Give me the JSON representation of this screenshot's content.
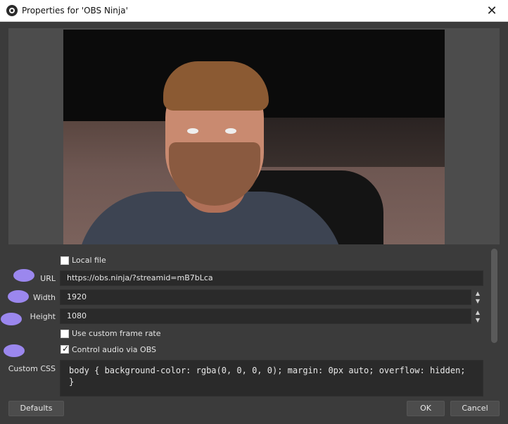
{
  "window": {
    "title": "Properties for 'OBS Ninja'",
    "close_glyph": "✕"
  },
  "form": {
    "local_file_label": "Local file",
    "local_file_checked": false,
    "url_label": "URL",
    "url_value": "https://obs.ninja/?streamid=mB7bLca",
    "width_label": "Width",
    "width_value": "1920",
    "height_label": "Height",
    "height_value": "1080",
    "custom_frame_rate_label": "Use custom frame rate",
    "custom_frame_rate_checked": false,
    "control_audio_label": "Control audio via OBS",
    "control_audio_checked": true,
    "custom_css_label": "Custom CSS",
    "custom_css_value": "body { background-color: rgba(0, 0, 0, 0); margin: 0px auto; overflow: hidden; }"
  },
  "buttons": {
    "defaults": "Defaults",
    "ok": "OK",
    "cancel": "Cancel"
  },
  "icons": {
    "spin_up": "▲",
    "spin_down": "▼"
  },
  "colors": {
    "background": "#3b3b3b",
    "field": "#2a2a2a",
    "annotation_blob": "#9b87ee"
  }
}
